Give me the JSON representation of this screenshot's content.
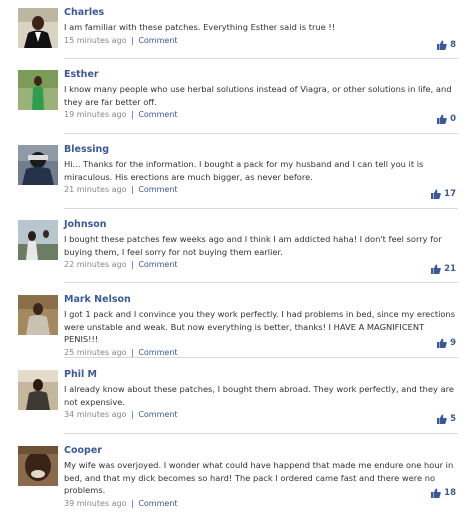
{
  "comments": [
    {
      "name": "Charles",
      "text": "I am familiar with these patches. Everything Esther said is true !!",
      "time": "15 minutes ago",
      "sep": "|",
      "link": "Comment",
      "likes": "8"
    },
    {
      "name": "Esther",
      "text": "I know many people who use herbal solutions instead of Viagra, or other solutions in life, and they are far better off.",
      "time": "19 minutes ago",
      "sep": "|",
      "link": "Comment",
      "likes": "0"
    },
    {
      "name": "Blessing",
      "text": "Hi... Thanks for the information. I bought a pack for my husband and I can tell you it is miraculous. His erections are much bigger, as never before.",
      "time": "21 minutes ago",
      "sep": "|",
      "link": "Comment",
      "likes": "17"
    },
    {
      "name": "Johnson",
      "text": "I bought these patches few weeks ago and I think I am addicted haha! I don't feel sorry for buying them, I feel sorry for not buying them earlier.",
      "time": "22 minutes ago",
      "sep": "|",
      "link": "Comment",
      "likes": "21"
    },
    {
      "name": "Mark Nelson",
      "text": "I got 1 pack and I convince you they work perfectly. I had problems in bed, since my erections were unstable and weak. But now everything is better, thanks! I HAVE A MAGNIFICENT PENIS!!!",
      "time": "25 minutes ago",
      "sep": "|",
      "link": "Comment",
      "likes": "9"
    },
    {
      "name": "Phil M",
      "text": "I already know about these patches, I bought them abroad. They work perfectly, and they are not expensive.",
      "time": "34 minutes ago",
      "sep": "|",
      "link": "Comment",
      "likes": "5"
    },
    {
      "name": "Cooper",
      "text": "My wife was overjoyed. I wonder what could have happend that made me endure one hour in bed, and that my dick becomes so hard! The pack I ordered came fast and there were no problems.",
      "time": "39 minutes ago",
      "sep": "|",
      "link": "Comment",
      "likes": "18"
    }
  ],
  "colors": {
    "link": "#3b5998",
    "divider": "#d8d8d8"
  },
  "icons": {
    "like": "thumbs-up-icon",
    "avatar": "user-photo"
  }
}
